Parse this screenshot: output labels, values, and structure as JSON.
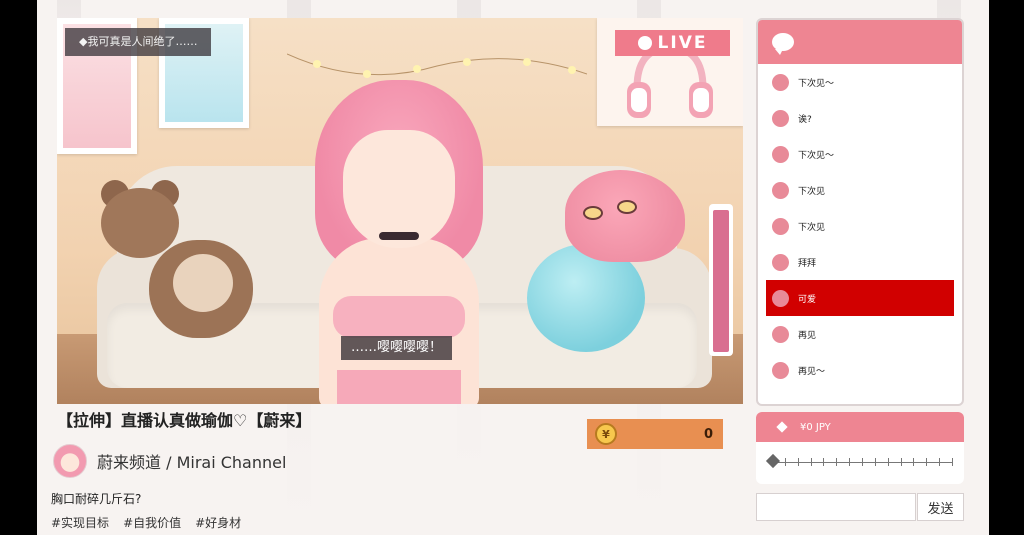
{
  "video": {
    "subtitle_top": "◆我可真是人间绝了……",
    "live_label": "LIVE",
    "subtitle_center": "……嘤嘤嘤嘤！"
  },
  "stream": {
    "title": "【拉伸】直播认真做瑜伽♡【蔚来】",
    "channel_name": "蔚来频道 / Mirai Channel",
    "description": "胸口耐碎几斤石?",
    "tags": [
      "#实现目标",
      "#自我价值",
      "#好身材"
    ]
  },
  "coins": {
    "symbol": "¥",
    "value": "0"
  },
  "chat": {
    "messages": [
      {
        "text": "下次见～",
        "highlight": false
      },
      {
        "text": "诶?",
        "highlight": false
      },
      {
        "text": "下次见～",
        "highlight": false
      },
      {
        "text": "下次见",
        "highlight": false
      },
      {
        "text": "下次见",
        "highlight": false
      },
      {
        "text": "拜拜",
        "highlight": false
      },
      {
        "text": "可爱",
        "highlight": true
      },
      {
        "text": "再见",
        "highlight": false
      },
      {
        "text": "再见～",
        "highlight": false
      }
    ]
  },
  "tip": {
    "amount_label": "¥0 JPY",
    "slider_level": 0
  },
  "input": {
    "value": "",
    "send_label": "发送"
  },
  "colors": {
    "accent_pink": "#ee8592",
    "highlight_red": "#d10000",
    "coin_orange": "#e88f51",
    "meter_pink": "#d96e90"
  }
}
